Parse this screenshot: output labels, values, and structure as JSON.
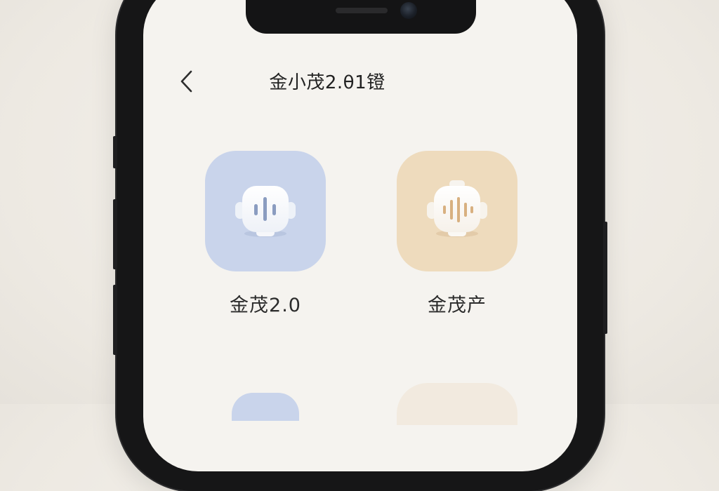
{
  "header": {
    "title": "金小茂2.θ1镫",
    "back_icon": "chevron-left-icon"
  },
  "apps": [
    {
      "label": "金茂2.0",
      "icon": "robot-assistant-icon",
      "bg_color": "#c9d4eb",
      "accent_color": "#7e92b8"
    },
    {
      "label": "金茂产",
      "icon": "robot-assistant-icon",
      "bg_color": "#eedbbd",
      "accent_color": "#d1a772"
    }
  ],
  "colors": {
    "background": "#efebe5",
    "screen": "#f5f3ef",
    "frame": "#161617"
  }
}
